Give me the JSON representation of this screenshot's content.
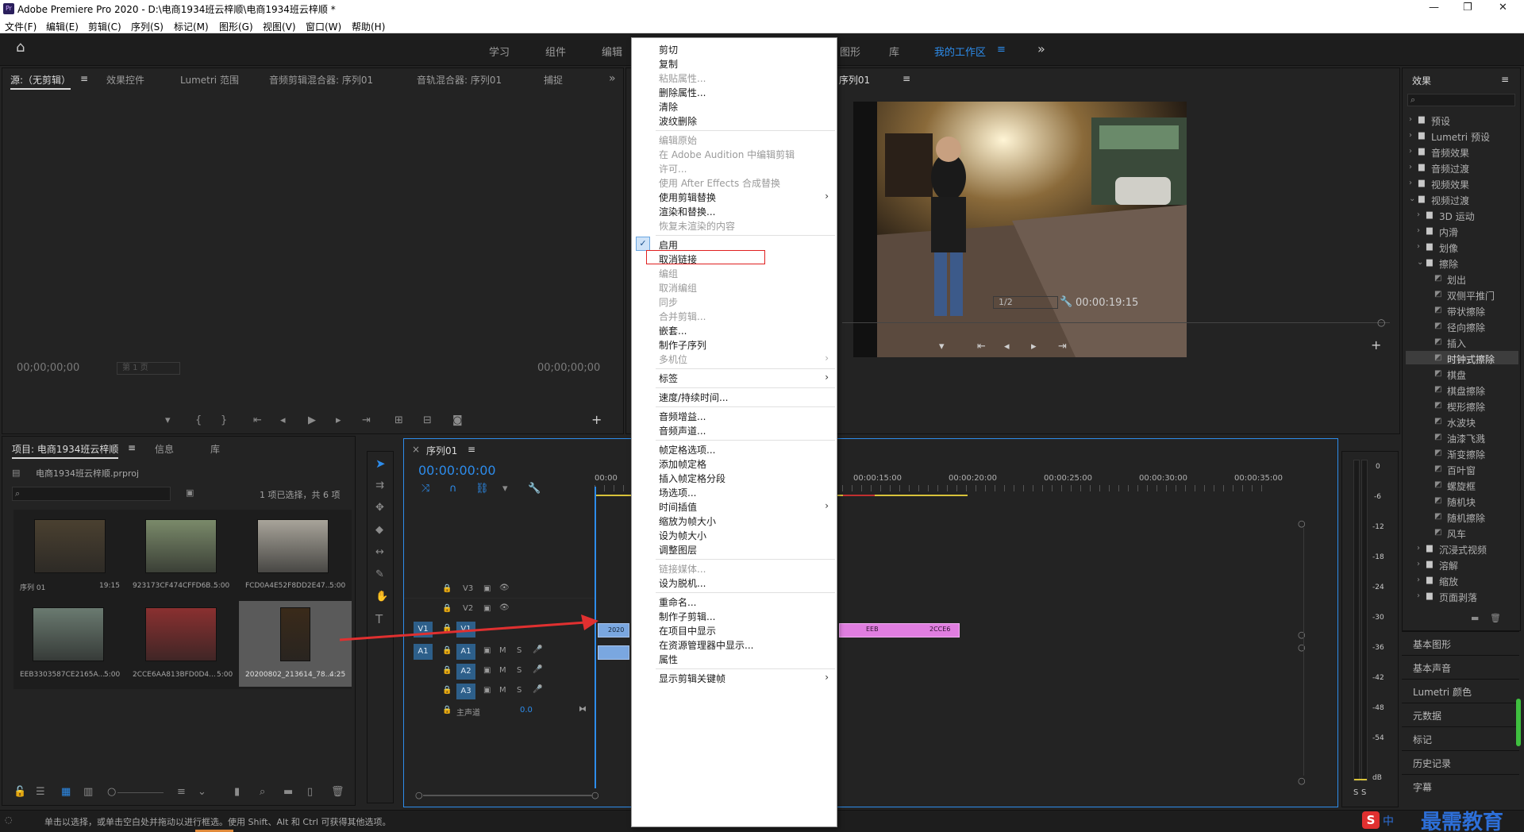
{
  "window": {
    "title": "Adobe Premiere Pro 2020 - D:\\电商1934班云梓顺\\电商1934班云梓顺 *",
    "app_badge": "Pr",
    "minimize": "—",
    "restore": "❐",
    "close": "✕"
  },
  "menubar": [
    "文件(F)",
    "编辑(E)",
    "剪辑(C)",
    "序列(S)",
    "标记(M)",
    "图形(G)",
    "视图(V)",
    "窗口(W)",
    "帮助(H)"
  ],
  "workspaces": {
    "items": [
      "学习",
      "组件",
      "编辑",
      "图形",
      "库"
    ],
    "active": "我的工作区",
    "more": "»",
    "menu_glyph": "≡"
  },
  "source_panel": {
    "tabs": [
      "源:（无剪辑）",
      "效果控件",
      "Lumetri 范围",
      "音频剪辑混合器: 序列01",
      "音轨混合器: 序列01",
      "捕捉"
    ],
    "tab_menu": "≡",
    "overflow": "»",
    "timecode_left": "00;00;00;00",
    "page": "第 1 页",
    "timecode_right": "00;00;00;00"
  },
  "program_panel": {
    "tab": "节目: 序列01",
    "tab_menu": "≡",
    "zoom": "1/2",
    "timecode": "00:00:19:15"
  },
  "project_panel": {
    "tabs": [
      "项目: 电商1934班云梓顺",
      "信息",
      "库"
    ],
    "tab_menu": "≡",
    "file": "电商1934班云梓顺.prproj",
    "selection_info": "1 项已选择，共 6 项",
    "items": [
      {
        "name": "序列 01",
        "duration": "19:15",
        "color": "#4a4030"
      },
      {
        "name": "923173CF474CFFD6B...",
        "duration": "5:00",
        "color": "#7a8a6a"
      },
      {
        "name": "FCD0A4E52F8DD2E47...",
        "duration": "5:00",
        "color": "#a8a49a"
      },
      {
        "name": "EEB3303587CE2165A...",
        "duration": "5:00",
        "color": "#6a7a70"
      },
      {
        "name": "2CCE6AA813BFD0D4...",
        "duration": "5:00",
        "color": "#8a3030"
      },
      {
        "name": "20200802_213614_78...",
        "duration": "4:25",
        "color": "#3a2a1a"
      }
    ]
  },
  "timeline": {
    "tab": "序列01",
    "tab_menu": "≡",
    "close": "×",
    "timecode": "00:00:00:00",
    "ruler": [
      "00:00",
      "00:00:15:00",
      "00:00:20:00",
      "00:00:25:00",
      "00:00:30:00",
      "00:00:35:00"
    ],
    "tracks": [
      {
        "target": "",
        "name": "V3"
      },
      {
        "target": "",
        "name": "V2"
      },
      {
        "target": "V1",
        "name": "V1"
      },
      {
        "target": "A1",
        "name": "A1"
      },
      {
        "target": "",
        "name": "A2"
      },
      {
        "target": "",
        "name": "A3"
      }
    ],
    "track_buttons": {
      "mute": "M",
      "solo": "S"
    },
    "master": {
      "label": "主声道",
      "value": "0.0"
    },
    "clips": [
      "2020",
      "EEB",
      "2CCE6"
    ]
  },
  "audio_meter": {
    "ticks": [
      "0",
      "-6",
      "-12",
      "-18",
      "-24",
      "-30",
      "-36",
      "-42",
      "-48",
      "-54",
      "dB"
    ],
    "solo_labels": [
      "S",
      "S"
    ]
  },
  "context_menu": [
    {
      "label": "剪切",
      "disabled": false
    },
    {
      "label": "复制",
      "disabled": false
    },
    {
      "label": "粘贴属性...",
      "disabled": true
    },
    {
      "label": "删除属性...",
      "disabled": false
    },
    {
      "label": "清除",
      "disabled": false
    },
    {
      "label": "波纹删除",
      "disabled": false
    },
    {
      "sep": true
    },
    {
      "label": "编辑原始",
      "disabled": true
    },
    {
      "label": "在 Adobe Audition 中编辑剪辑",
      "disabled": true
    },
    {
      "label": "许可...",
      "disabled": true
    },
    {
      "label": "使用 After Effects 合成替换",
      "disabled": true
    },
    {
      "label": "使用剪辑替换",
      "disabled": false,
      "submenu": true
    },
    {
      "label": "渲染和替换...",
      "disabled": false
    },
    {
      "label": "恢复未渲染的内容",
      "disabled": true
    },
    {
      "sep": true
    },
    {
      "label": "启用",
      "disabled": false,
      "checked": true
    },
    {
      "label": "取消链接",
      "disabled": false,
      "highlight": true
    },
    {
      "label": "编组",
      "disabled": true
    },
    {
      "label": "取消编组",
      "disabled": true
    },
    {
      "label": "同步",
      "disabled": true
    },
    {
      "label": "合并剪辑...",
      "disabled": true
    },
    {
      "label": "嵌套...",
      "disabled": false
    },
    {
      "label": "制作子序列",
      "disabled": false
    },
    {
      "label": "多机位",
      "disabled": true,
      "submenu": true
    },
    {
      "sep": true
    },
    {
      "label": "标签",
      "disabled": false,
      "submenu": true
    },
    {
      "sep": true
    },
    {
      "label": "速度/持续时间...",
      "disabled": false
    },
    {
      "sep": true
    },
    {
      "label": "音频增益...",
      "disabled": false
    },
    {
      "label": "音频声道...",
      "disabled": false
    },
    {
      "sep": true
    },
    {
      "label": "帧定格选项...",
      "disabled": false
    },
    {
      "label": "添加帧定格",
      "disabled": false
    },
    {
      "label": "插入帧定格分段",
      "disabled": false
    },
    {
      "label": "场选项...",
      "disabled": false
    },
    {
      "label": "时间插值",
      "disabled": false,
      "submenu": true
    },
    {
      "label": "缩放为帧大小",
      "disabled": false
    },
    {
      "label": "设为帧大小",
      "disabled": false
    },
    {
      "label": "调整图层",
      "disabled": false
    },
    {
      "sep": true
    },
    {
      "label": "链接媒体...",
      "disabled": true
    },
    {
      "label": "设为脱机...",
      "disabled": false
    },
    {
      "sep": true
    },
    {
      "label": "重命名...",
      "disabled": false
    },
    {
      "label": "制作子剪辑...",
      "disabled": false
    },
    {
      "label": "在项目中显示",
      "disabled": false
    },
    {
      "label": "在资源管理器中显示...",
      "disabled": false
    },
    {
      "label": "属性",
      "disabled": false
    },
    {
      "sep": true
    },
    {
      "label": "显示剪辑关键帧",
      "disabled": false,
      "submenu": true
    }
  ],
  "effects_panel": {
    "tab": "效果",
    "tab_menu": "≡",
    "tree": [
      {
        "label": "预设",
        "level": 0,
        "type": "folder",
        "open": false
      },
      {
        "label": "Lumetri 预设",
        "level": 0,
        "type": "folder",
        "open": false
      },
      {
        "label": "音频效果",
        "level": 0,
        "type": "folder",
        "open": false
      },
      {
        "label": "音频过渡",
        "level": 0,
        "type": "folder",
        "open": false
      },
      {
        "label": "视频效果",
        "level": 0,
        "type": "folder",
        "open": false
      },
      {
        "label": "视频过渡",
        "level": 0,
        "type": "folder",
        "open": true
      },
      {
        "label": "3D 运动",
        "level": 1,
        "type": "folder",
        "open": false
      },
      {
        "label": "内滑",
        "level": 1,
        "type": "folder",
        "open": false
      },
      {
        "label": "划像",
        "level": 1,
        "type": "folder",
        "open": false
      },
      {
        "label": "擦除",
        "level": 1,
        "type": "folder",
        "open": true
      },
      {
        "label": "划出",
        "level": 2,
        "type": "item"
      },
      {
        "label": "双侧平推门",
        "level": 2,
        "type": "item"
      },
      {
        "label": "带状擦除",
        "level": 2,
        "type": "item"
      },
      {
        "label": "径向擦除",
        "level": 2,
        "type": "item"
      },
      {
        "label": "插入",
        "level": 2,
        "type": "item"
      },
      {
        "label": "时钟式擦除",
        "level": 2,
        "type": "item",
        "selected": true
      },
      {
        "label": "棋盘",
        "level": 2,
        "type": "item"
      },
      {
        "label": "棋盘擦除",
        "level": 2,
        "type": "item"
      },
      {
        "label": "楔形擦除",
        "level": 2,
        "type": "item"
      },
      {
        "label": "水波块",
        "level": 2,
        "type": "item"
      },
      {
        "label": "油漆飞溅",
        "level": 2,
        "type": "item"
      },
      {
        "label": "渐变擦除",
        "level": 2,
        "type": "item"
      },
      {
        "label": "百叶窗",
        "level": 2,
        "type": "item"
      },
      {
        "label": "螺旋框",
        "level": 2,
        "type": "item"
      },
      {
        "label": "随机块",
        "level": 2,
        "type": "item"
      },
      {
        "label": "随机擦除",
        "level": 2,
        "type": "item"
      },
      {
        "label": "风车",
        "level": 2,
        "type": "item"
      },
      {
        "label": "沉浸式视频",
        "level": 1,
        "type": "folder",
        "open": false
      },
      {
        "label": "溶解",
        "level": 1,
        "type": "folder",
        "open": false
      },
      {
        "label": "缩放",
        "level": 1,
        "type": "folder",
        "open": false
      },
      {
        "label": "页面剥落",
        "level": 1,
        "type": "folder",
        "open": false
      }
    ],
    "panels": [
      "基本图形",
      "基本声音",
      "Lumetri 颜色",
      "元数据",
      "标记",
      "历史记录",
      "字幕"
    ]
  },
  "status_bar": {
    "text": "单击以选择，或单击空白处并拖动以进行框选。使用 Shift、Alt 和 Ctrl 可获得其他选项。"
  },
  "watermark": {
    "ime": "中",
    "text": "最需教育"
  },
  "colors": {
    "accent": "#2d8ceb",
    "clip_pink": "#e07ee0",
    "clip_blue": "#7aa7e0",
    "highlight_box": "#e02020",
    "arrow": "#e03030"
  }
}
